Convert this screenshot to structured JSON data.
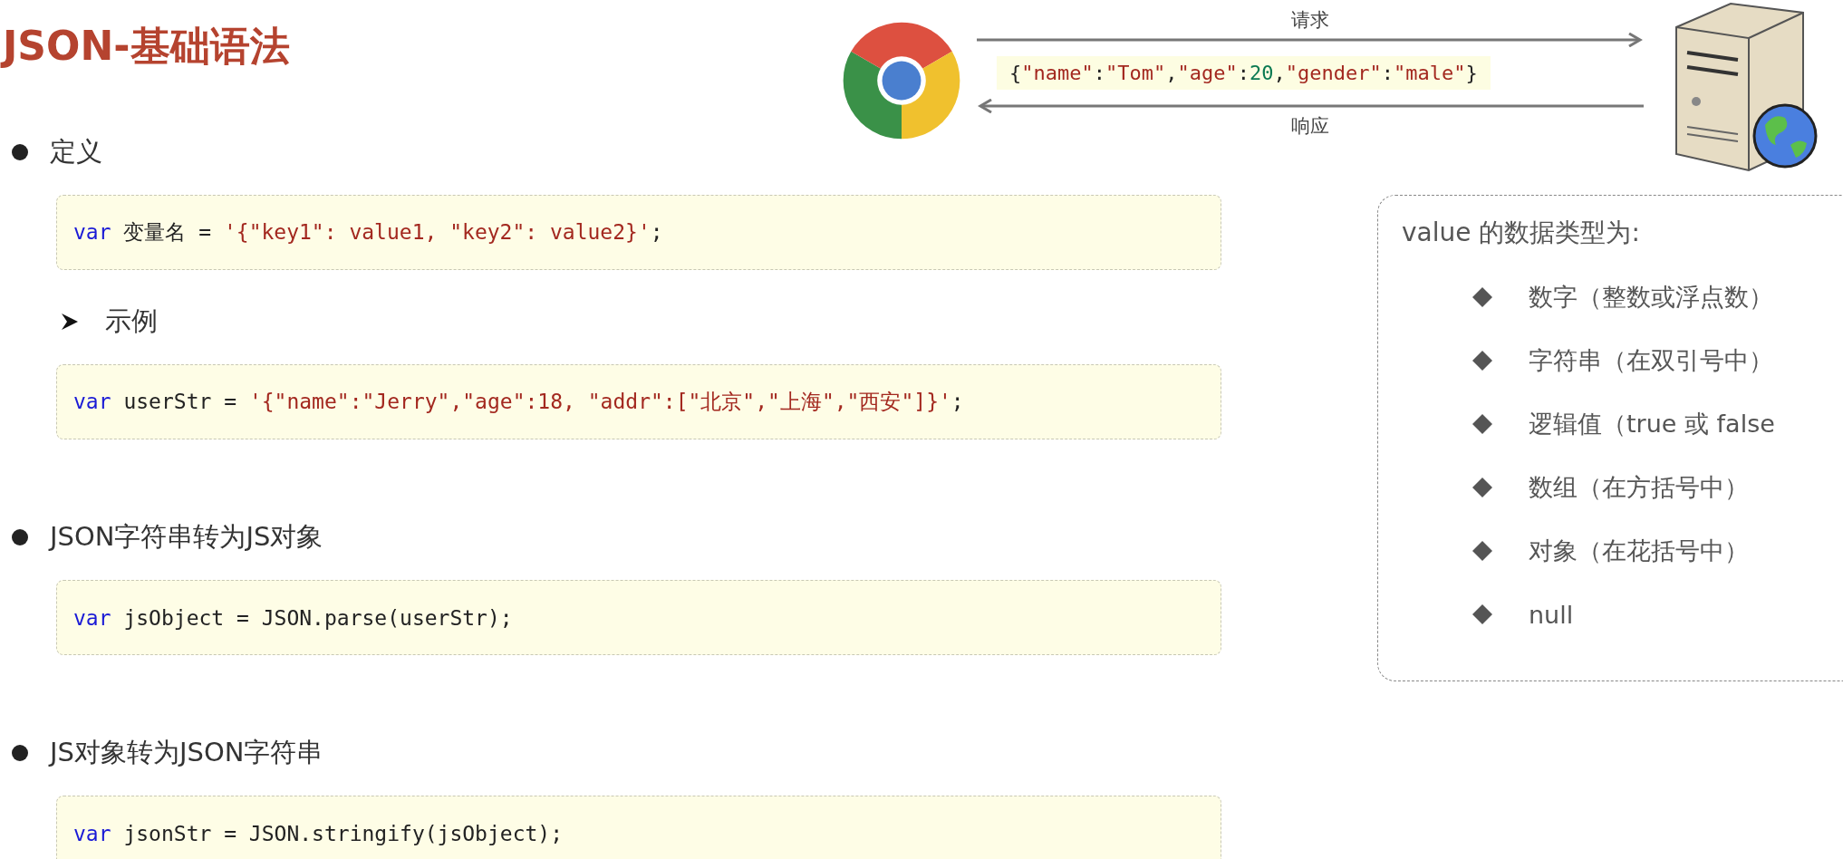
{
  "title": "JSON-基础语法",
  "diagram": {
    "request_label": "请求",
    "response_label": "响应",
    "payload": [
      {
        "kind": "plain",
        "text": "{"
      },
      {
        "kind": "string",
        "text": "\"name\""
      },
      {
        "kind": "plain",
        "text": ":"
      },
      {
        "kind": "string",
        "text": "\"Tom\""
      },
      {
        "kind": "plain",
        "text": ","
      },
      {
        "kind": "string",
        "text": "\"age\""
      },
      {
        "kind": "plain",
        "text": ":"
      },
      {
        "kind": "number",
        "text": "20"
      },
      {
        "kind": "plain",
        "text": ","
      },
      {
        "kind": "string",
        "text": "\"gender\""
      },
      {
        "kind": "plain",
        "text": ":"
      },
      {
        "kind": "string",
        "text": "\"male\""
      },
      {
        "kind": "plain",
        "text": "}"
      }
    ]
  },
  "sections": [
    {
      "kind": "bullet",
      "heading": "定义",
      "code": [
        {
          "kind": "keyword",
          "text": "var"
        },
        {
          "kind": "plain",
          "text": " 变量名 = "
        },
        {
          "kind": "string",
          "text": "'{\"key1\": value1, \"key2\": value2}'"
        },
        {
          "kind": "plain",
          "text": ";"
        }
      ]
    },
    {
      "kind": "arrow",
      "heading": "示例",
      "code": [
        {
          "kind": "keyword",
          "text": "var"
        },
        {
          "kind": "plain",
          "text": " userStr = "
        },
        {
          "kind": "string",
          "text": "'{\"name\":\"Jerry\",\"age\":18, \"addr\":[\"北京\",\"上海\",\"西安\"]}'"
        },
        {
          "kind": "plain",
          "text": ";"
        }
      ]
    },
    {
      "kind": "bullet",
      "heading": "JSON字符串转为JS对象",
      "code": [
        {
          "kind": "keyword",
          "text": "var"
        },
        {
          "kind": "plain",
          "text": " jsObject = JSON.parse(userStr);"
        }
      ]
    },
    {
      "kind": "bullet",
      "heading": "JS对象转为JSON字符串",
      "code": [
        {
          "kind": "keyword",
          "text": "var"
        },
        {
          "kind": "plain",
          "text": " jsonStr = JSON.stringify(jsObject);"
        }
      ]
    }
  ],
  "value_types": {
    "title": "value 的数据类型为:",
    "items": [
      "数字（整数或浮点数）",
      "字符串（在双引号中）",
      "逻辑值（true 或 false",
      "数组（在方括号中）",
      "对象（在花括号中）",
      "null"
    ]
  }
}
